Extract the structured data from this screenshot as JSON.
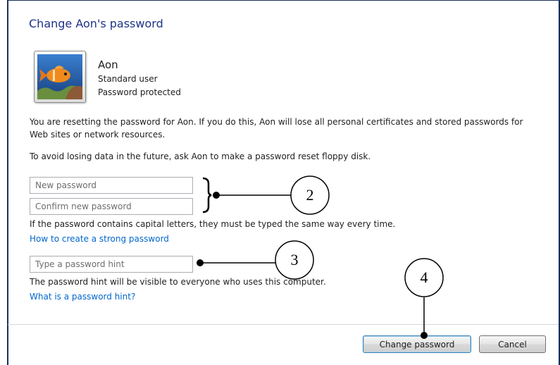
{
  "dialog": {
    "title": "Change Aon's password",
    "user": {
      "name": "Aon",
      "role": "Standard user",
      "status": "Password protected"
    },
    "warning_text": "You are resetting the password for Aon.  If you do this, Aon will lose all personal certificates and stored passwords for Web sites or network resources.",
    "advice_text": "To avoid losing data in the future, ask Aon to make a password reset floppy disk.",
    "new_password": {
      "placeholder": "New password",
      "value": ""
    },
    "confirm_password": {
      "placeholder": "Confirm new password",
      "value": ""
    },
    "capital_note": "If the password contains capital letters, they must be typed the same way every time.",
    "strong_password_link": "How to create a strong password",
    "hint": {
      "placeholder": "Type a password hint",
      "value": ""
    },
    "hint_note": "The password hint will be visible to everyone who uses this computer.",
    "hint_link": "What is a password hint?",
    "buttons": {
      "change": "Change password",
      "cancel": "Cancel"
    }
  },
  "annotations": {
    "callout_2": "2",
    "callout_3": "3",
    "callout_4": "4"
  },
  "colors": {
    "title": "#1e3287",
    "link": "#0066cc",
    "frame": "#1a2f5e"
  },
  "icons": {
    "user_picture": "clownfish-picture-icon"
  }
}
